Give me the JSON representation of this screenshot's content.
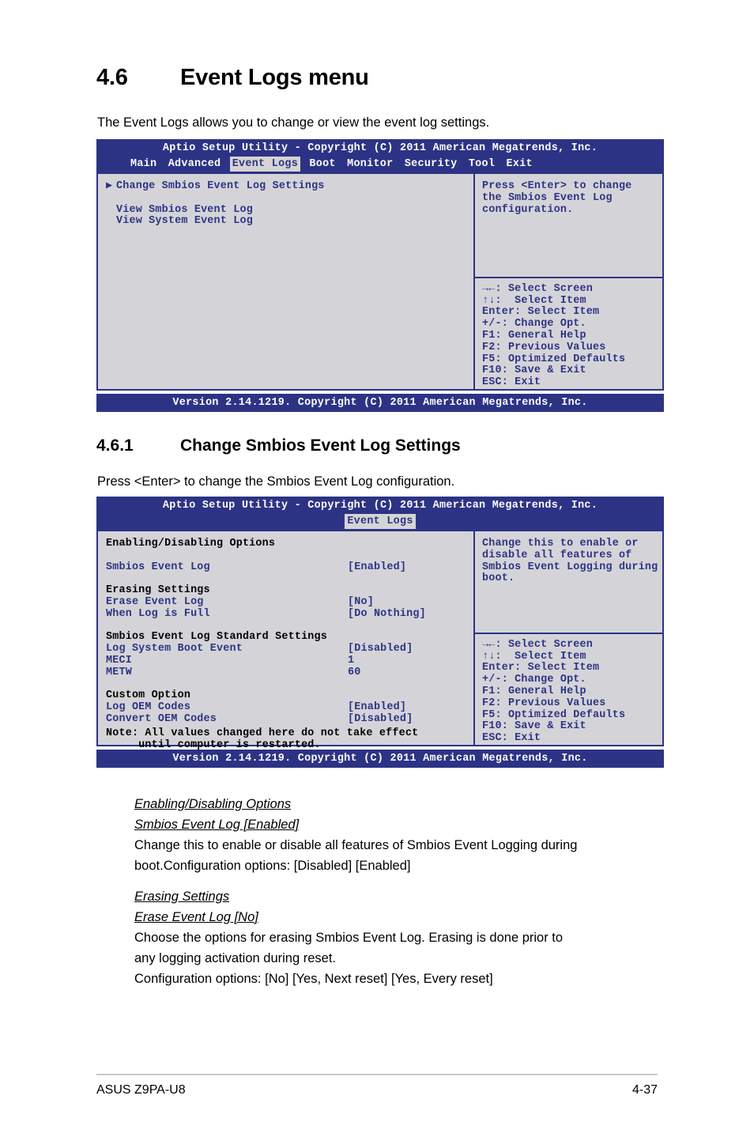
{
  "section": {
    "number": "4.6",
    "title": "Event Logs menu",
    "intro": "The Event Logs allows you to change or view the event log settings."
  },
  "subsection": {
    "number": "4.6.1",
    "title": "Change Smbios Event Log Settings",
    "intro": "Press <Enter> to change the Smbios Event Log configuration."
  },
  "bios_screen_1": {
    "title": "Aptio Setup Utility - Copyright (C) 2011 American Megatrends, Inc.",
    "menu": [
      {
        "label": "Main",
        "active": false
      },
      {
        "label": "Advanced",
        "active": false
      },
      {
        "label": "Event Logs",
        "active": true
      },
      {
        "label": "Boot",
        "active": false
      },
      {
        "label": "Monitor",
        "active": false
      },
      {
        "label": "Security",
        "active": false
      },
      {
        "label": "Tool",
        "active": false
      },
      {
        "label": "Exit",
        "active": false
      }
    ],
    "items": [
      {
        "marker": "▶",
        "label": "Change Smbios Event Log Settings"
      },
      {
        "marker": "",
        "label": ""
      },
      {
        "marker": "",
        "label": "View Smbios Event Log"
      },
      {
        "marker": "",
        "label": "View System Event Log"
      }
    ],
    "help": [
      "Press <Enter> to change",
      "the Smbios Event Log",
      "configuration."
    ],
    "nav": [
      "→←: Select Screen",
      "↑↓:  Select Item",
      "Enter: Select Item",
      "+/-: Change Opt.",
      "F1: General Help",
      "F2: Previous Values",
      "F5: Optimized Defaults",
      "F10: Save & Exit",
      "ESC: Exit"
    ],
    "footer": "Version 2.14.1219. Copyright (C) 2011 American Megatrends, Inc."
  },
  "bios_screen_2": {
    "title": "Aptio Setup Utility - Copyright (C) 2011 American Megatrends, Inc.",
    "menu": [
      {
        "label": "Event Logs",
        "active": true
      }
    ],
    "groups": [
      {
        "heading": "Enabling/Disabling Options",
        "blank_after_heading": true,
        "rows": [
          {
            "name": "Smbios Event Log",
            "value": "[Enabled]"
          }
        ]
      },
      {
        "heading": "Erasing Settings",
        "blank_after_heading": false,
        "rows": [
          {
            "name": "Erase Event Log",
            "value": "[No]"
          },
          {
            "name": "When Log is Full",
            "value": "[Do Nothing]"
          }
        ]
      },
      {
        "heading": "Smbios Event Log Standard Settings",
        "blank_after_heading": false,
        "rows": [
          {
            "name": "Log System Boot Event",
            "value": "[Disabled]"
          },
          {
            "name": "MECI",
            "value": "1"
          },
          {
            "name": "METW",
            "value": "60"
          }
        ]
      },
      {
        "heading": "Custom Option",
        "blank_after_heading": false,
        "rows": [
          {
            "name": "Log OEM Codes",
            "value": "[Enabled]"
          },
          {
            "name": "Convert OEM Codes",
            "value": "[Disabled]"
          }
        ]
      }
    ],
    "note": [
      "Note: All values changed here do not take effect",
      "     until computer is restarted."
    ],
    "help": [
      "Change this to enable or",
      "disable all features of",
      "Smbios Event Logging during",
      "boot."
    ],
    "nav": [
      "→←: Select Screen",
      "↑↓:  Select Item",
      "Enter: Select Item",
      "+/-: Change Opt.",
      "F1: General Help",
      "F2: Previous Values",
      "F5: Optimized Defaults",
      "F10: Save & Exit",
      "ESC: Exit"
    ],
    "footer": "Version 2.14.1219. Copyright (C) 2011 American Megatrends, Inc."
  },
  "descriptions": [
    {
      "heading": "Enabling/Disabling Options",
      "item": "Smbios Event Log [Enabled]",
      "lines": [
        "Change this to enable or disable all features of Smbios Event Logging during",
        "boot.Configuration options: [Disabled] [Enabled]"
      ]
    },
    {
      "heading": "Erasing Settings",
      "item": "Erase Event Log [No]",
      "lines": [
        "Choose the options for erasing Smbios Event Log. Erasing is done prior to",
        "any logging activation during reset.",
        "Configuration options: [No] [Yes, Next reset] [Yes, Every reset]"
      ]
    }
  ],
  "page_footer": {
    "left": "ASUS Z9PA-U8",
    "right": "4-37"
  }
}
